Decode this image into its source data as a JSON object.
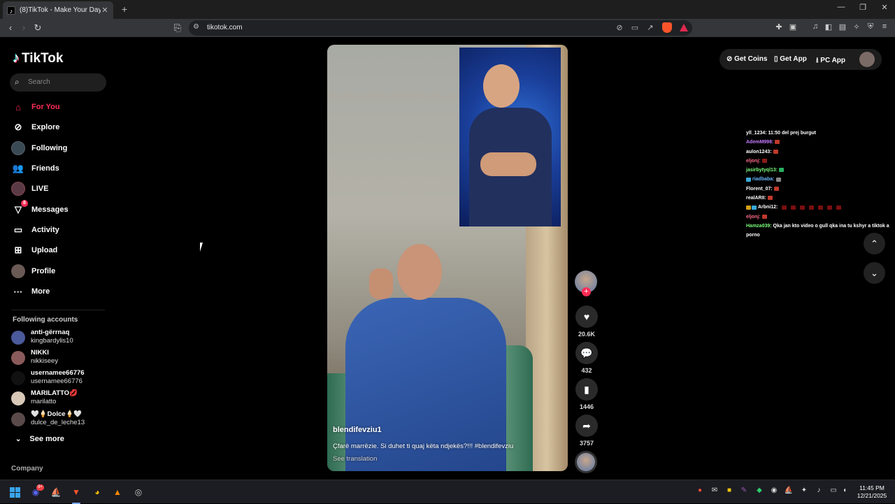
{
  "browser": {
    "tab_title": "(8)TikTok - Make Your Day",
    "url": "tikotok.com"
  },
  "sidebar": {
    "logo": "TikTok",
    "search_placeholder": "Search",
    "nav": [
      {
        "label": "For You",
        "icon": "home-icon",
        "active": true
      },
      {
        "label": "Explore",
        "icon": "compass-icon"
      },
      {
        "label": "Following",
        "icon": "following-avatar-icon"
      },
      {
        "label": "Friends",
        "icon": "friends-icon"
      },
      {
        "label": "LIVE",
        "icon": "live-icon"
      },
      {
        "label": "Messages",
        "icon": "messages-icon",
        "badge": "8"
      },
      {
        "label": "Activity",
        "icon": "activity-icon"
      },
      {
        "label": "Upload",
        "icon": "upload-icon"
      },
      {
        "label": "Profile",
        "icon": "profile-avatar-icon"
      },
      {
        "label": "More",
        "icon": "more-icon"
      }
    ],
    "following_title": "Following accounts",
    "accounts": [
      {
        "name": "anti-gërrnaq",
        "handle": "kingbardylis10"
      },
      {
        "name": "NIKKI",
        "handle": "nikkiseey"
      },
      {
        "name": "usernamee66776",
        "handle": "usernamee66776"
      },
      {
        "name": "MARILATTO💋",
        "handle": "marilatto"
      },
      {
        "name": "🤍🍦Dolce🍦🤍",
        "handle": "dulce_de_leche13"
      }
    ],
    "see_more": "See more",
    "company": "Company"
  },
  "video": {
    "username": "blendifevziu1",
    "caption": "Çfarë marrëzie. Si duhet ti quaj këta ndjekës?!!! #blendifevziu",
    "see_translation": "See translation",
    "likes": "20.6K",
    "comments": "432",
    "saves": "1446",
    "shares": "3757"
  },
  "top_right": {
    "get_coins": "Get Coins",
    "get_app": "Get App",
    "pc_app": "PC App"
  },
  "chat": [
    {
      "user": "yll_1234:",
      "text": "11:50 del prej burgut",
      "color": "#ffffff"
    },
    {
      "user": "AdemM998:",
      "text": "",
      "color": "#c77dff",
      "emoji": "#c0392b"
    },
    {
      "user": "aulon1243:",
      "text": "",
      "color": "#ffffff",
      "emoji": "#c0392b"
    },
    {
      "user": "eljonj:",
      "text": "",
      "color": "#ff6b8a",
      "emoji": "#8b1a1a"
    },
    {
      "user": "jasirbytyql13:",
      "text": "",
      "color": "#7dff7d",
      "emoji": "#27ae60"
    },
    {
      "user": "riadbaba:",
      "text": "",
      "color": "#6ab7ff",
      "emoji": "#888888"
    },
    {
      "user": "Florent_07:",
      "text": "",
      "color": "#ffffff",
      "emoji": "#c0392b"
    },
    {
      "user": "realARII:",
      "text": "",
      "color": "#ffffff",
      "emoji": "#c0392b"
    },
    {
      "user": "Arbni12:",
      "text": "",
      "color": "#ffffff",
      "emoji": "#7a0f0f"
    },
    {
      "user": "eljonj:",
      "text": "",
      "color": "#ff6b8a",
      "emoji": "#c0392b"
    },
    {
      "user": "Hamza039:",
      "text": "Qka jan kto video o gull qka ina tu kshyr a tiktok a porno",
      "color": "#7dff7d"
    }
  ],
  "taskbar": {
    "time": "11:45 PM",
    "date": "12/21/2025",
    "discord_badge": "9+"
  }
}
